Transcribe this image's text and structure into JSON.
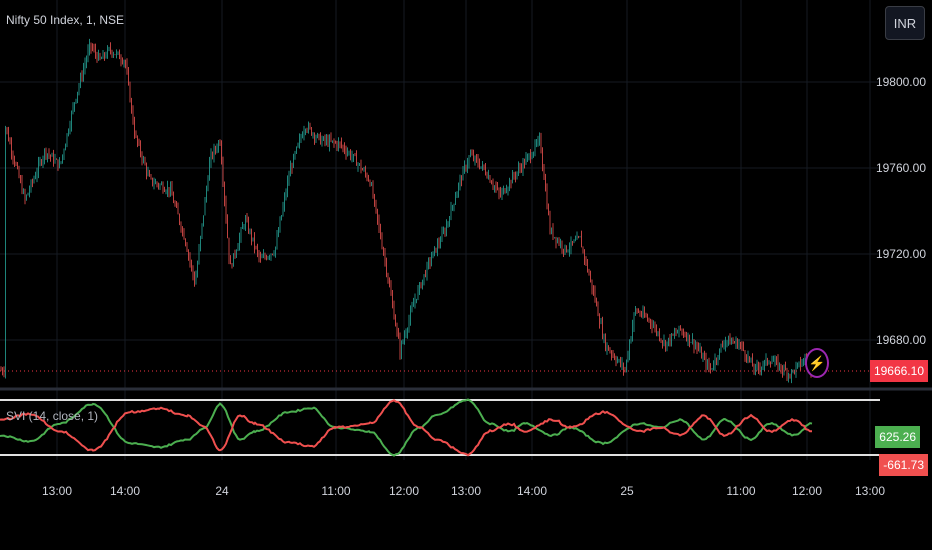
{
  "header": {
    "symbol_title": "Nifty 50 Index, 1, NSE",
    "currency_button": "INR"
  },
  "indicator": {
    "title": "SVI (14, close, 1)"
  },
  "colors": {
    "up": "#26a69a",
    "down": "#ef5350",
    "svi_up": "#4caf50",
    "svi_down": "#f0504f",
    "last_price": "#f23645",
    "alert": "#9c27b0"
  },
  "chart_data": {
    "type": "candlestick",
    "title": "Nifty 50 Index, 1, NSE",
    "y_ticks": [
      19800,
      19760,
      19720,
      19680
    ],
    "y_tick_labels": [
      "19800.00",
      "19760.00",
      "19720.00",
      "19680.00"
    ],
    "ylim": [
      19632,
      19838
    ],
    "x_ticks": [
      {
        "bar": 57,
        "label": "13:00"
      },
      {
        "bar": 125,
        "label": "14:00"
      },
      {
        "bar": 222,
        "label": "24"
      },
      {
        "bar": 336,
        "label": "11:00"
      },
      {
        "bar": 404,
        "label": "12:00"
      },
      {
        "bar": 466,
        "label": "13:00"
      },
      {
        "bar": 532,
        "label": "14:00"
      },
      {
        "bar": 627,
        "label": "25"
      },
      {
        "bar": 741,
        "label": "11:00"
      },
      {
        "bar": 807,
        "label": "12:00"
      },
      {
        "bar": 870,
        "label": "13:00"
      }
    ],
    "close_path": [
      [
        5,
        19780
      ],
      [
        25,
        19745
      ],
      [
        45,
        19768
      ],
      [
        60,
        19761
      ],
      [
        75,
        19792
      ],
      [
        90,
        19817
      ],
      [
        100,
        19810
      ],
      [
        110,
        19815
      ],
      [
        125,
        19810
      ],
      [
        135,
        19775
      ],
      [
        150,
        19754
      ],
      [
        170,
        19750
      ],
      [
        185,
        19727
      ],
      [
        195,
        19706
      ],
      [
        210,
        19764
      ],
      [
        220,
        19773
      ],
      [
        230,
        19713
      ],
      [
        245,
        19736
      ],
      [
        260,
        19717
      ],
      [
        275,
        19722
      ],
      [
        290,
        19759
      ],
      [
        305,
        19780
      ],
      [
        320,
        19773
      ],
      [
        340,
        19771
      ],
      [
        355,
        19764
      ],
      [
        370,
        19754
      ],
      [
        385,
        19717
      ],
      [
        400,
        19675
      ],
      [
        415,
        19699
      ],
      [
        430,
        19717
      ],
      [
        445,
        19731
      ],
      [
        460,
        19754
      ],
      [
        470,
        19766
      ],
      [
        485,
        19759
      ],
      [
        500,
        19747
      ],
      [
        515,
        19757
      ],
      [
        530,
        19766
      ],
      [
        540,
        19773
      ],
      [
        550,
        19731
      ],
      [
        565,
        19722
      ],
      [
        580,
        19727
      ],
      [
        595,
        19699
      ],
      [
        605,
        19678
      ],
      [
        625,
        19666
      ],
      [
        635,
        19694
      ],
      [
        650,
        19689
      ],
      [
        665,
        19678
      ],
      [
        680,
        19685
      ],
      [
        695,
        19678
      ],
      [
        710,
        19666
      ],
      [
        725,
        19680
      ],
      [
        740,
        19678
      ],
      [
        755,
        19666
      ],
      [
        770,
        19671
      ],
      [
        790,
        19664
      ],
      [
        805,
        19671
      ],
      [
        812,
        19666.1
      ]
    ],
    "last_price": "19666.10",
    "svi": {
      "name": "SVI (14, close, 1)",
      "ylim": [
        -700,
        700
      ],
      "green": [
        [
          0,
          -200
        ],
        [
          30,
          -350
        ],
        [
          60,
          100
        ],
        [
          93,
          600
        ],
        [
          130,
          -400
        ],
        [
          159,
          -500
        ],
        [
          188,
          -300
        ],
        [
          205,
          0
        ],
        [
          220,
          600
        ],
        [
          240,
          -300
        ],
        [
          255,
          -100
        ],
        [
          290,
          400
        ],
        [
          312,
          500
        ],
        [
          335,
          0
        ],
        [
          370,
          -100
        ],
        [
          394,
          -700
        ],
        [
          420,
          0
        ],
        [
          435,
          300
        ],
        [
          468,
          700
        ],
        [
          490,
          100
        ],
        [
          510,
          -100
        ],
        [
          525,
          100
        ],
        [
          553,
          -200
        ],
        [
          570,
          0
        ],
        [
          603,
          -400
        ],
        [
          640,
          100
        ],
        [
          660,
          0
        ],
        [
          680,
          200
        ],
        [
          704,
          -300
        ],
        [
          725,
          200
        ],
        [
          751,
          -300
        ],
        [
          770,
          100
        ],
        [
          794,
          -200
        ],
        [
          812,
          100
        ]
      ],
      "green_last": "625.26",
      "red_last": "-661.73"
    }
  }
}
